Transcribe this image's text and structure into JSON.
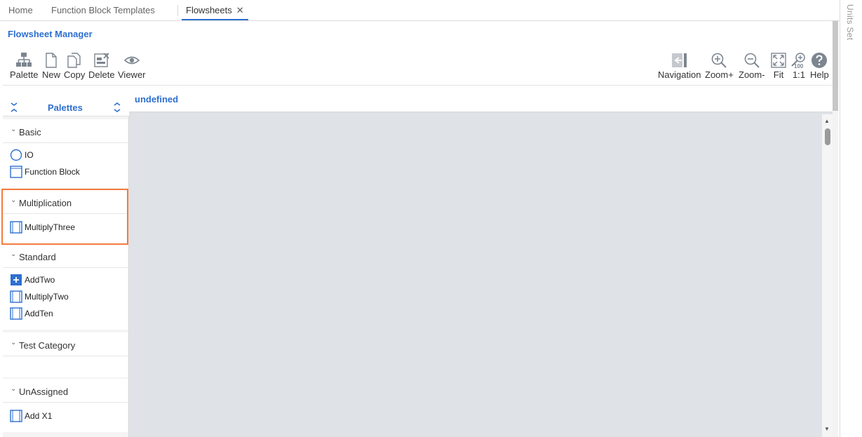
{
  "tabs": [
    {
      "label": "Home",
      "active": false
    },
    {
      "label": "Function Block Templates",
      "active": false
    },
    {
      "label": "Flowsheets",
      "active": true,
      "close": "✕"
    }
  ],
  "rail": {
    "label": "Units Set"
  },
  "header": {
    "title": "Flowsheet Manager"
  },
  "toolbar": {
    "left": [
      {
        "label": "Palette",
        "icon": "palette-icon"
      },
      {
        "label": "New",
        "icon": "new-document-icon"
      },
      {
        "label": "Copy",
        "icon": "copy-icon"
      },
      {
        "label": "Delete",
        "icon": "delete-icon"
      },
      {
        "label": "Viewer",
        "icon": "eye-icon"
      }
    ],
    "right": [
      {
        "label": "Navigation",
        "icon": "navigation-icon"
      },
      {
        "label": "Zoom+",
        "icon": "zoom-in-icon"
      },
      {
        "label": "Zoom-",
        "icon": "zoom-out-icon"
      },
      {
        "label": "Fit",
        "icon": "fit-icon"
      },
      {
        "label": "1:1",
        "icon": "actual-size-icon",
        "badge": "100"
      },
      {
        "label": "Help",
        "icon": "help-icon"
      }
    ]
  },
  "palette": {
    "title": "Palettes",
    "categories": [
      {
        "name": "Basic",
        "items": [
          {
            "label": "IO",
            "icon": "circle-icon"
          },
          {
            "label": "Function Block",
            "icon": "block-icon"
          }
        ]
      },
      {
        "name": "Multiplication",
        "items": [
          {
            "label": "MultiplyThree",
            "icon": "block-icon"
          }
        ]
      },
      {
        "name": "Standard",
        "items": [
          {
            "label": "AddTwo",
            "icon": "plus-block-icon"
          },
          {
            "label": "MultiplyTwo",
            "icon": "block-icon"
          },
          {
            "label": "AddTen",
            "icon": "block-icon"
          }
        ]
      },
      {
        "name": "Test Category",
        "items": []
      },
      {
        "name": "UnAssigned",
        "items": [
          {
            "label": "Add X1",
            "icon": "block-icon"
          }
        ]
      }
    ]
  },
  "canvas": {
    "title": "undefined"
  },
  "colors": {
    "accent": "#2e6fd0",
    "highlight": "#f47b3f",
    "canvas": "#dfe2e6"
  }
}
